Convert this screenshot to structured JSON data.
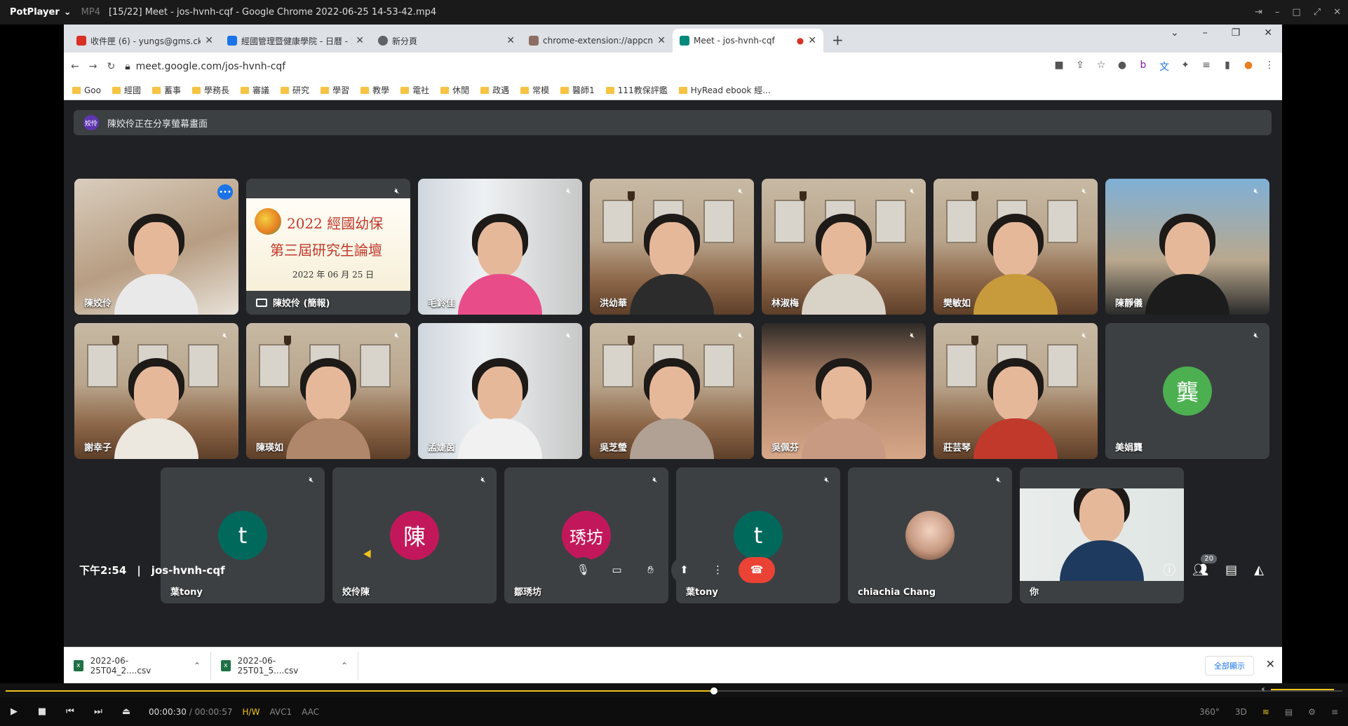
{
  "player": {
    "app": "PotPlayer",
    "format": "MP4",
    "title": "[15/22] Meet - jos-hvnh-cqf - Google Chrome 2022-06-25 14-53-42.mp4",
    "time_current": "00:00:30",
    "time_total": "00:00:57",
    "progress": 0.53,
    "tags": [
      "H/W",
      "AVC1",
      "AAC"
    ],
    "right_labels": [
      "360°",
      "3D"
    ],
    "volume": 1.0
  },
  "browser": {
    "tabs": [
      {
        "title": "收件匣 (6) - yungs@gms.cku.ec",
        "color": "#d93025"
      },
      {
        "title": "經國管理暨健康學院 - 日曆 - 20",
        "color": "#1a73e8"
      },
      {
        "title": "新分頁",
        "color": "#5f6368"
      },
      {
        "title": "chrome-extension://appcnhiel",
        "color": "#8d6e63"
      },
      {
        "title": "Meet - jos-hvnh-cqf",
        "color": "#00897b"
      }
    ],
    "url": "meet.google.com/jos-hvnh-cqf",
    "bookmarks": [
      "Goo",
      "經國",
      "蓄事",
      "學務長",
      "審議",
      "研究",
      "學習",
      "教學",
      "電社",
      "休閒",
      "政遇",
      "常模",
      "醫師1",
      "111教保評鑑",
      "HyRead ebook 經..."
    ]
  },
  "meet": {
    "banner": "陳姣伶正在分享螢幕畫面",
    "banner_avatar": "姣伶",
    "slide": {
      "line1": "2022 經國幼保",
      "line2": "第三屆研究生論壇",
      "line3": "2022 年 06 月 25 日",
      "presenter_label": "陳姣伶 (簡報)"
    },
    "row1": [
      "陳姣伶",
      "陳姣伶 (簡報)",
      "毛鈴佳",
      "洪幼華",
      "林淑梅",
      "樊敏如",
      "陳靜儀"
    ],
    "row2": [
      "謝幸子",
      "陳瑛如",
      "孟婕茵",
      "吳芝瑩",
      "吳佩芬",
      "莊芸琴",
      "美娟龔"
    ],
    "row3": [
      "葉tony",
      "姣伶陳",
      "鄒琇坊",
      "葉tony",
      "chiachia Chang",
      "你"
    ],
    "initials": {
      "row2_last": "龔",
      "r3_0": "t",
      "r3_1": "陳",
      "r3_2": "琇坊",
      "r3_3": "t"
    },
    "clock": "下午2:54",
    "meeting_code": "jos-hvnh-cqf",
    "participant_count": "20",
    "colors": {
      "accent_blue": "#8ab4f8",
      "end_call_red": "#ea4335",
      "green_avatar": "#4caf50",
      "teal_avatar": "#00695c",
      "pink_avatar": "#c2185b"
    }
  },
  "downloads": {
    "items": [
      "2022-06-25T04_2....csv",
      "2022-06-25T01_5....csv"
    ],
    "show_all": "全部顯示"
  }
}
